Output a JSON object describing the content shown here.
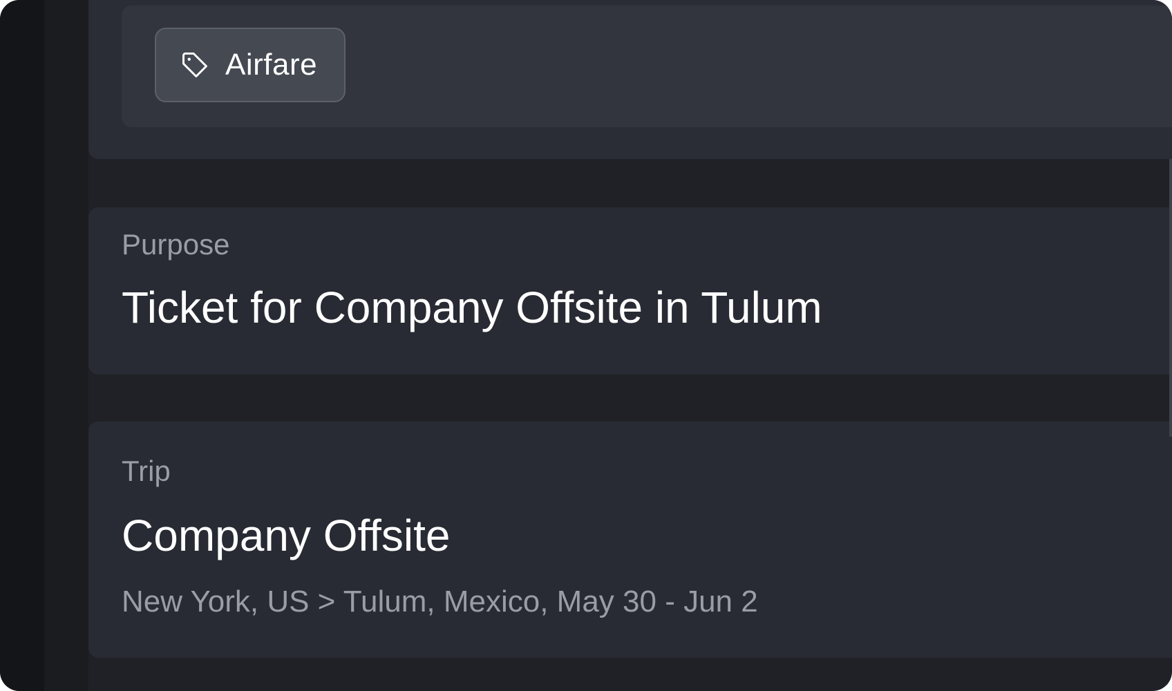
{
  "category": {
    "icon": "tag-icon",
    "label": "Airfare"
  },
  "purpose": {
    "label": "Purpose",
    "value": "Ticket for Company Offsite in Tulum"
  },
  "trip": {
    "label": "Trip",
    "name": "Company Offsite",
    "details": "New York, US > Tulum, Mexico, May 30 - Jun 2"
  },
  "colors": {
    "background": "#202126",
    "card": "#282b33",
    "chip": "#454952",
    "text_primary": "#ffffff",
    "text_secondary": "#9a9da6"
  }
}
